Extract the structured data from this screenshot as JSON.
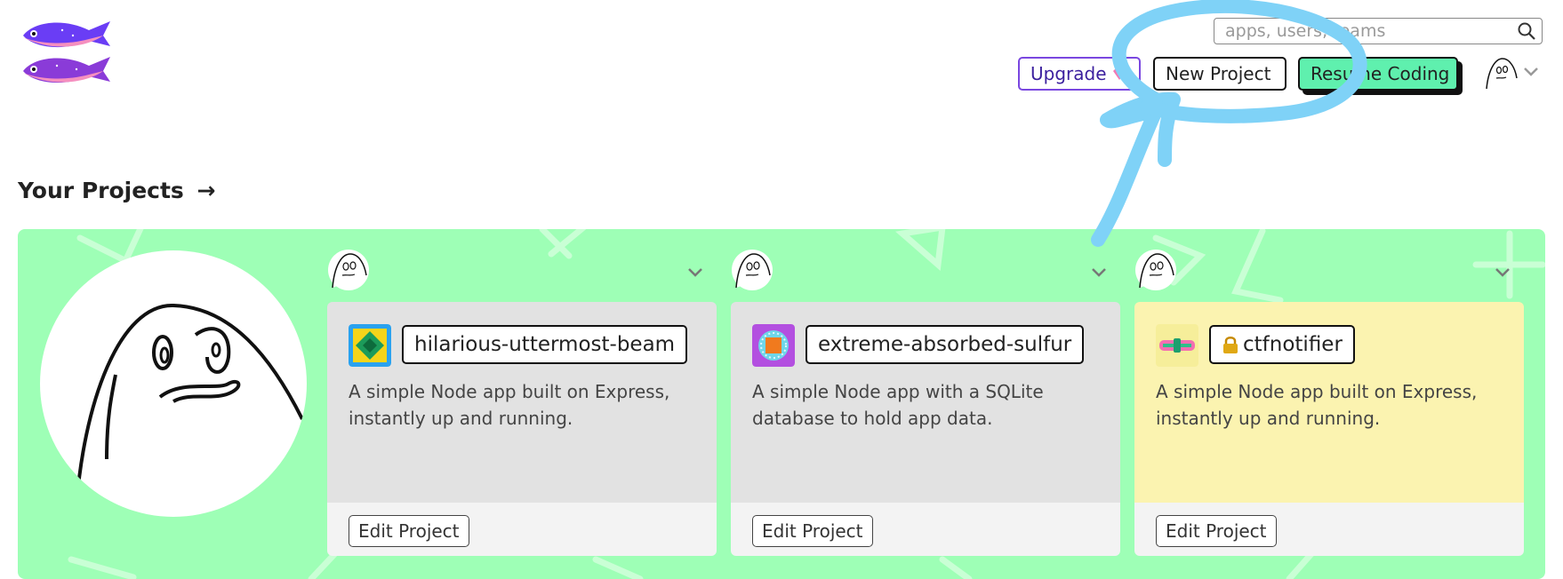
{
  "header": {
    "search_placeholder": "apps, users, teams",
    "upgrade_label": "Upgrade",
    "new_project_label": "New Project",
    "resume_coding_label": "Resume Coding"
  },
  "section": {
    "title": "Your Projects",
    "arrow": "→"
  },
  "projects": [
    {
      "name": "hilarious-uttermost-beam",
      "description": "A simple Node app built on Express, instantly up and running.",
      "edit_label": "Edit Project",
      "private": false,
      "card_color": "#e2e2e2",
      "icon": "green-diamond-icon"
    },
    {
      "name": "extreme-absorbed-sulfur",
      "description": "A simple Node app with a SQLite database to hold app data.",
      "edit_label": "Edit Project",
      "private": false,
      "card_color": "#e2e2e2",
      "icon": "orange-gear-icon"
    },
    {
      "name": "ctfnotifier",
      "description": "A simple Node app built on Express, instantly up and running.",
      "edit_label": "Edit Project",
      "private": true,
      "card_color": "#fbf3b0",
      "icon": "pink-bar-icon"
    }
  ],
  "colors": {
    "panel_bg": "#9effb6",
    "resume_button_bg": "#5ff0ae",
    "upgrade_border": "#7a47e0",
    "annotation_stroke": "#7fd2f7"
  }
}
